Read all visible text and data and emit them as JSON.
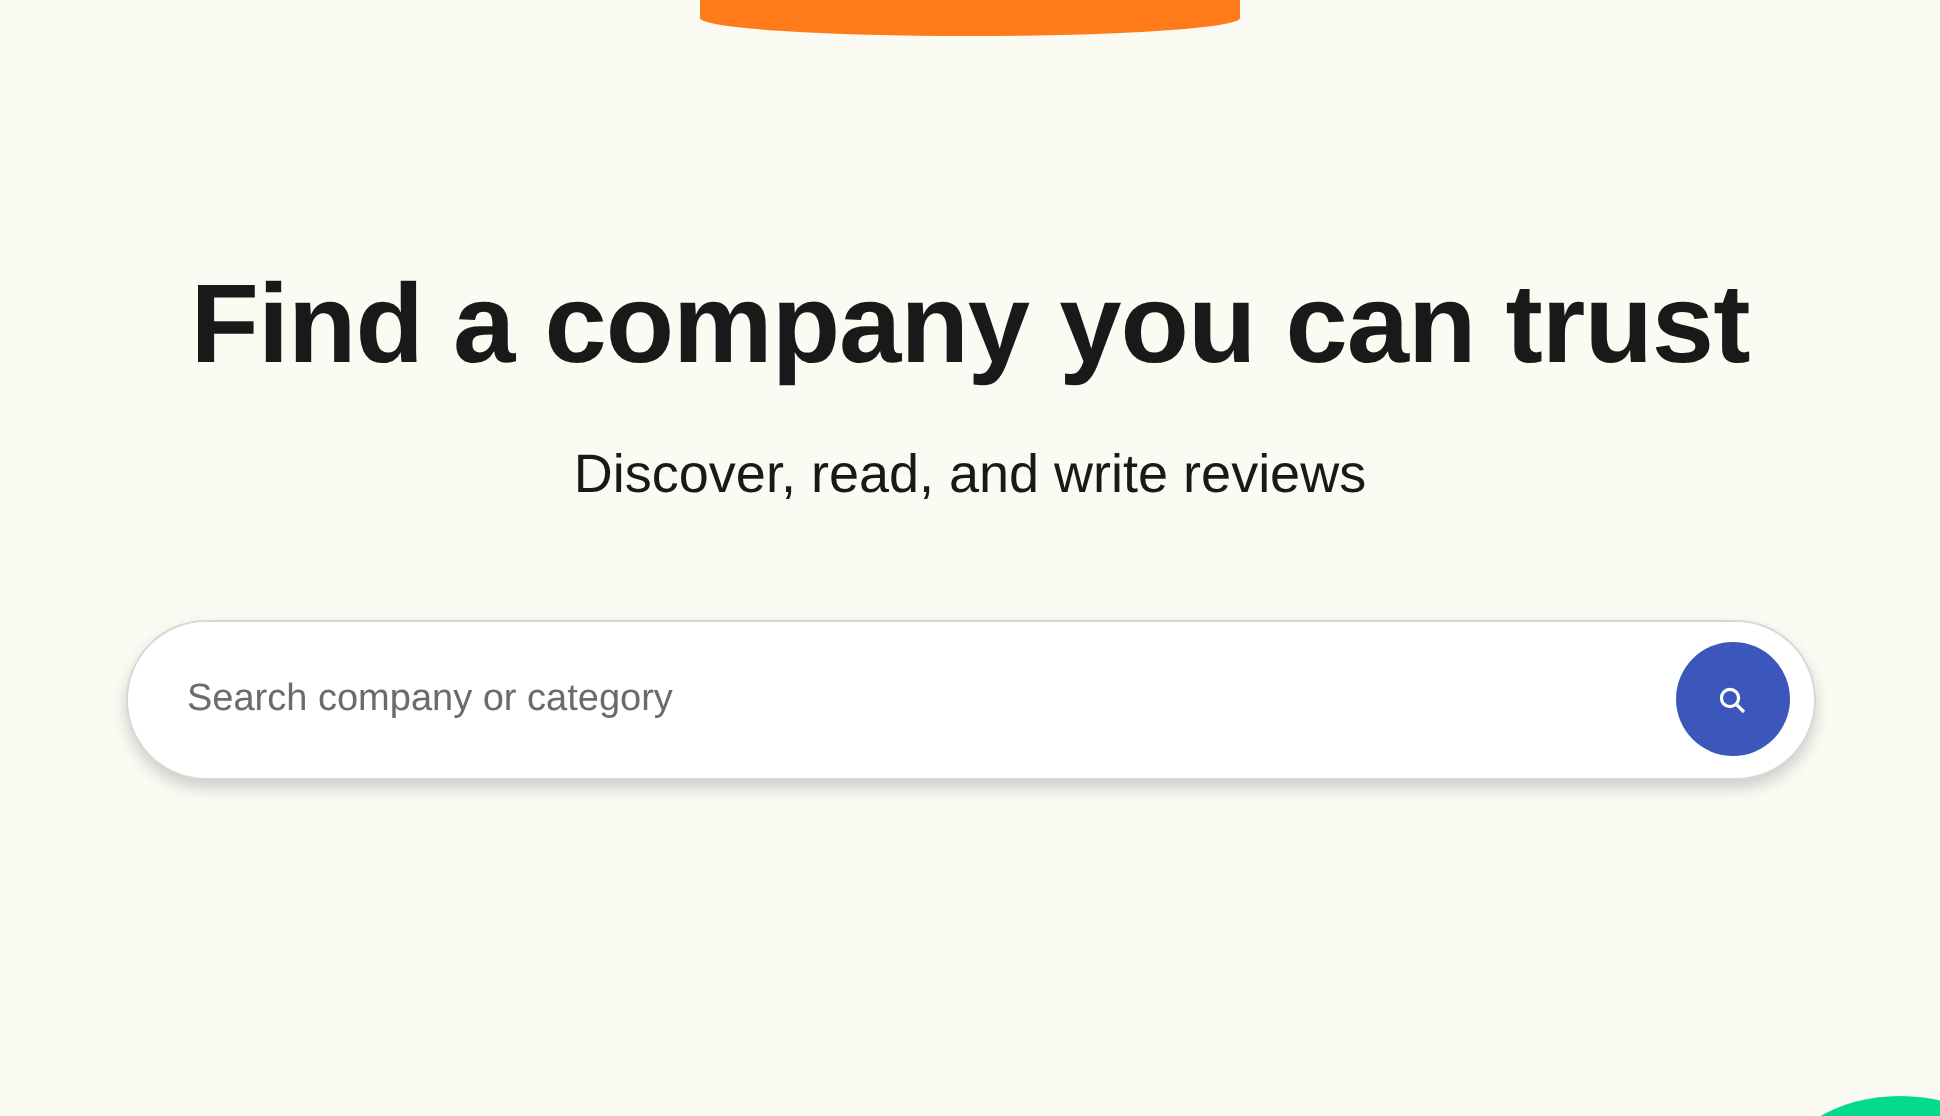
{
  "hero": {
    "title": "Find a company you can trust",
    "subtitle": "Discover, read, and write reviews"
  },
  "search": {
    "placeholder": "Search company or category"
  }
}
